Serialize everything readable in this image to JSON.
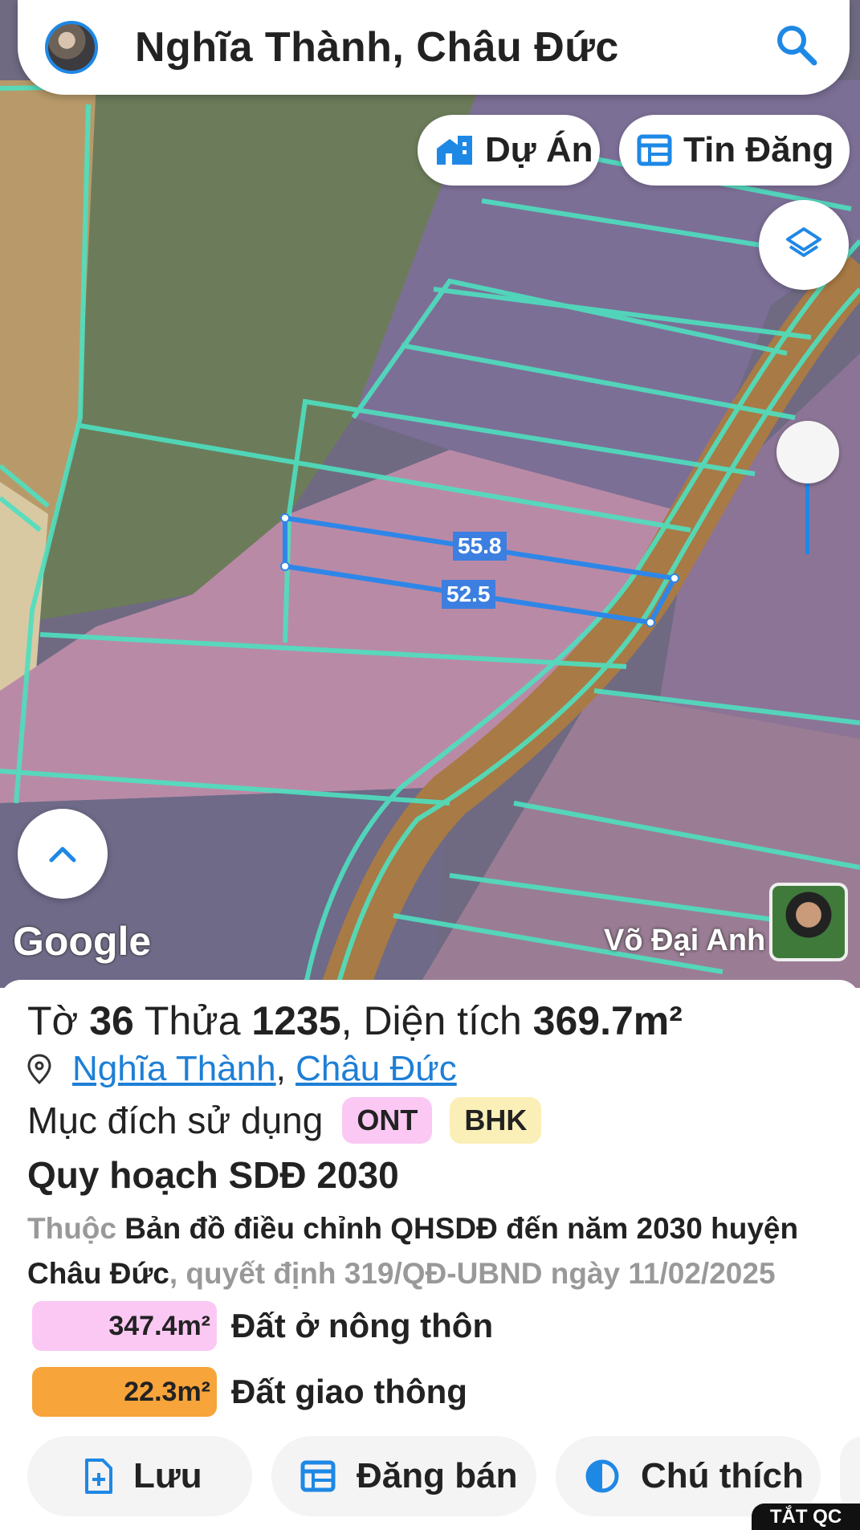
{
  "search": {
    "title": "Nghĩa Thành, Châu Đức",
    "search_icon": "search-icon"
  },
  "chips": {
    "du_an": "Dự Án",
    "tin_dang": "Tin Đăng"
  },
  "map": {
    "google": "Google",
    "watermark": "Võ Đại Anh",
    "measure_top": "55.8",
    "measure_bottom": "52.5"
  },
  "parcel": {
    "to_label": "Tờ",
    "to_value": "36",
    "thua_label": "Thửa",
    "thua_value": "1235",
    "dientich_label": ", Diện tích",
    "dientich_value": "369.7m²",
    "ward": "Nghĩa Thành",
    "district": "Châu Đức",
    "muc_dich_label": "Mục đích sử dụng",
    "tags": [
      "ONT",
      "BHK"
    ],
    "quy_hoach_title": "Quy hoạch SDĐ 2030",
    "thuoc_label": "Thuộc",
    "plan_name": "Bản đồ điều chỉnh QHSDĐ đến năm 2030 huyện Châu Đức",
    "decision": ", quyết định 319/QĐ-UBND ngày 11/02/2025",
    "legend": [
      {
        "amount": "347.4m²",
        "label": "Đất ở nông thôn",
        "color": "#fbc8f4"
      },
      {
        "amount": "22.3m²",
        "label": "Đất giao thông",
        "color": "#f7a43a"
      }
    ]
  },
  "actions": {
    "luu": "Lưu",
    "dang_ban": "Đăng bán",
    "chu_thich": "Chú thích"
  },
  "ads_label": "TẮT QC",
  "colors": {
    "accent": "#1e88e5",
    "parcel_line": "#4ee0c0"
  }
}
